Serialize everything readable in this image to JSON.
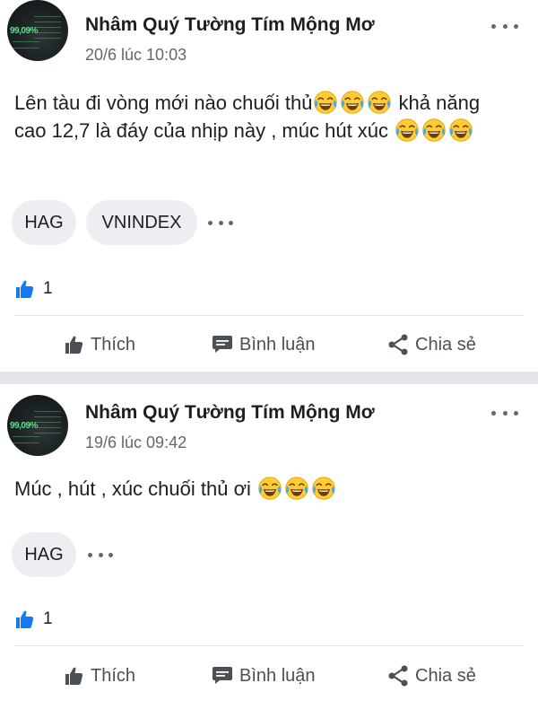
{
  "posts": [
    {
      "author": "Nhâm Quý Tường Tím Mộng Mơ",
      "timestamp": "20/6 lúc 10:03",
      "avatar_text": "99,09%",
      "content_part1": "Lên tàu đi vòng mới nào chuối thủ",
      "content_part2": " khả năng cao 12,7 là đáy của nhịp này , múc hút xúc ",
      "tags": [
        "HAG",
        "VNINDEX"
      ],
      "like_count": "1",
      "actions": {
        "like": "Thích",
        "comment": "Bình luận",
        "share": "Chia sẻ"
      }
    },
    {
      "author": "Nhâm Quý Tường Tím Mộng Mơ",
      "timestamp": "19/6 lúc 09:42",
      "avatar_text": "99,09%",
      "content_part1": "Múc , hút , xúc chuối thủ ơi ",
      "tags": [
        "HAG"
      ],
      "like_count": "1",
      "actions": {
        "like": "Thích",
        "comment": "Bình luận",
        "share": "Chia sẻ"
      }
    }
  ],
  "icons": {
    "more": "more-horizontal-icon",
    "emoji": "face-with-tears-of-joy-icon",
    "like_badge": "thumbs-up-badge-icon",
    "like": "thumbs-up-icon",
    "comment": "comment-bubble-icon",
    "share": "share-icon"
  },
  "colors": {
    "like_blue": "#1877f2",
    "text_primary": "#1c1e21",
    "text_secondary": "#65676b",
    "tag_background": "#eceef1",
    "separator": "#e4e6ea"
  }
}
